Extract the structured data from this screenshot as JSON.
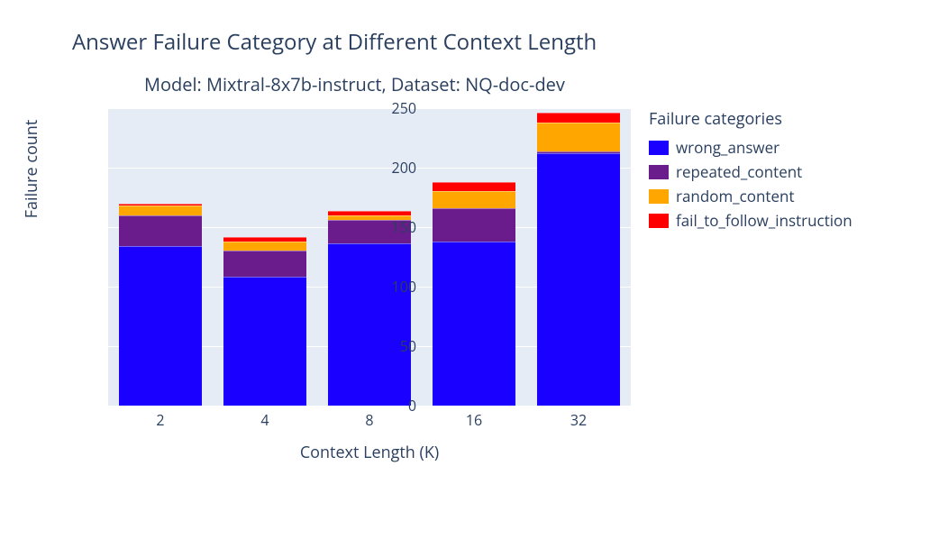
{
  "title": "Answer Failure Category at Different Context Length",
  "subtitle": "Model: Mixtral-8x7b-instruct, Dataset: NQ-doc-dev",
  "xlabel": "Context Length (K)",
  "ylabel": "Failure count",
  "legend_title": "Failure categories",
  "chart_data": {
    "type": "bar",
    "stacked": true,
    "categories": [
      "2",
      "4",
      "8",
      "16",
      "32"
    ],
    "series": [
      {
        "name": "wrong_answer",
        "color": "#1900ff",
        "values": [
          134,
          108,
          136,
          138,
          212
        ]
      },
      {
        "name": "repeated_content",
        "color": "#6b1c8c",
        "values": [
          26,
          22,
          20,
          28,
          2
        ]
      },
      {
        "name": "random_content",
        "color": "#ffa600",
        "values": [
          8,
          8,
          4,
          14,
          24
        ]
      },
      {
        "name": "fail_to_follow_instruction",
        "color": "#ff0000",
        "values": [
          2,
          4,
          4,
          8,
          8
        ]
      }
    ],
    "ylim": [
      0,
      250
    ],
    "yticks": [
      0,
      50,
      100,
      150,
      200,
      250
    ]
  }
}
